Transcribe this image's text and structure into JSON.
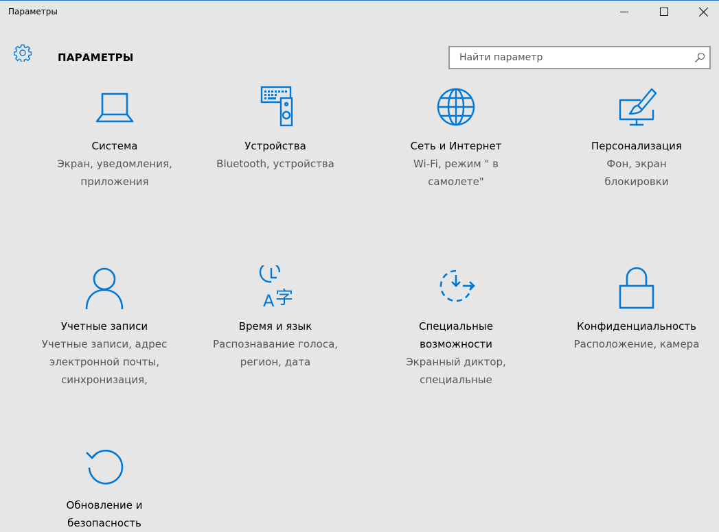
{
  "window": {
    "title": "Параметры",
    "controls": [
      "minimize",
      "maximize",
      "close"
    ]
  },
  "header": {
    "title": "ПАРАМЕТРЫ",
    "icon": "gear-icon"
  },
  "search": {
    "placeholder": "Найти параметр",
    "value": "",
    "icon": "search-icon"
  },
  "accent_color": "#0078d7",
  "tiles": [
    {
      "key": "system",
      "icon": "laptop-icon",
      "name": "Система",
      "desc": "Экран, уведомления, приложения"
    },
    {
      "key": "devices",
      "icon": "devices-icon",
      "name": "Устройства",
      "desc": "Bluetooth, устройства"
    },
    {
      "key": "network",
      "icon": "globe-icon",
      "name": "Сеть и Интернет",
      "desc": "Wi-Fi, режим \" в самолете\""
    },
    {
      "key": "personalization",
      "icon": "personalization-icon",
      "name": "Персонализация",
      "desc": "Фон, экран блокировки"
    },
    {
      "key": "accounts",
      "icon": "person-icon",
      "name": "Учетные записи",
      "desc": "Учетные записи, адрес электронной почты, синхронизация,"
    },
    {
      "key": "time-language",
      "icon": "time-language-icon",
      "name": "Время и язык",
      "desc": "Распознавание голоса, регион, дата"
    },
    {
      "key": "ease-of-access",
      "icon": "ease-of-access-icon",
      "name": "Специальные возможности",
      "desc": "Экранный диктор, специальные"
    },
    {
      "key": "privacy",
      "icon": "lock-icon",
      "name": "Конфиденциальность",
      "desc": "Расположение, камера"
    },
    {
      "key": "update-security",
      "icon": "update-icon",
      "name": "Обновление и безопасность",
      "desc": ""
    }
  ]
}
